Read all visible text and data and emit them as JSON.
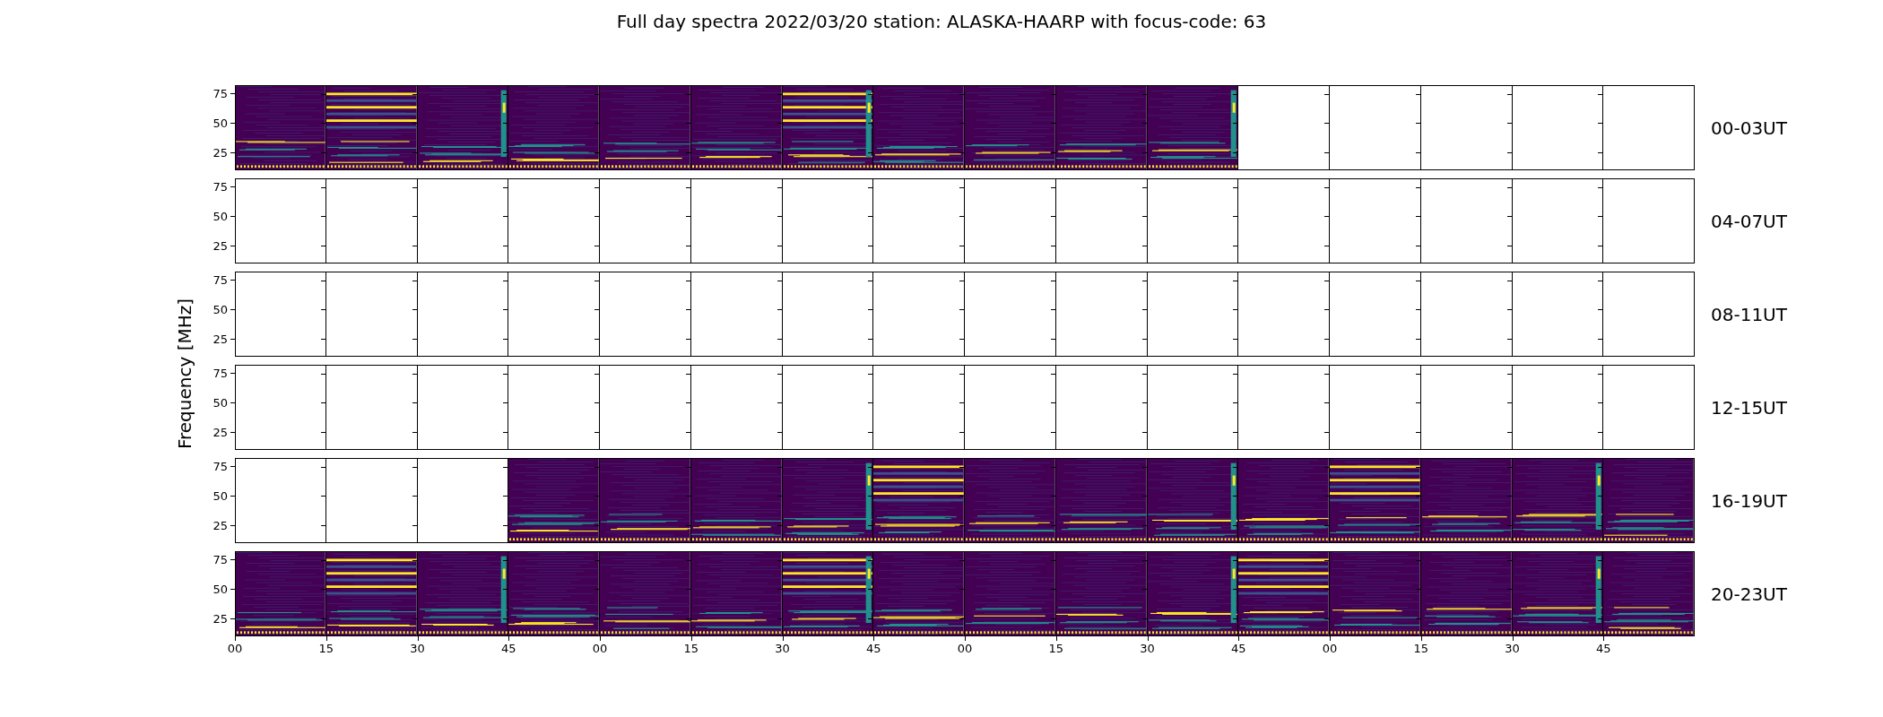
{
  "title": "Full day spectra 2022/03/20 station: ALASKA-HAARP with focus-code: 63",
  "ylabel": "Frequency [MHz]",
  "x_ticks": [
    "00",
    "15",
    "30",
    "45",
    "00",
    "15",
    "30",
    "45",
    "00",
    "15",
    "30",
    "45",
    "00",
    "15",
    "30",
    "45"
  ],
  "rows": [
    {
      "label": "00-03UT",
      "y_ticks": [
        "75",
        "50",
        "25"
      ],
      "panels": [
        {
          "has_data": true
        },
        {
          "has_data": true
        },
        {
          "has_data": true
        },
        {
          "has_data": true
        },
        {
          "has_data": true
        },
        {
          "has_data": true
        },
        {
          "has_data": true
        },
        {
          "has_data": true
        },
        {
          "has_data": true
        },
        {
          "has_data": true
        },
        {
          "has_data": true
        },
        {
          "has_data": false
        },
        {
          "has_data": false
        },
        {
          "has_data": false
        },
        {
          "has_data": false
        },
        {
          "has_data": false
        }
      ]
    },
    {
      "label": "04-07UT",
      "y_ticks": [
        "75",
        "50",
        "25"
      ],
      "panels": [
        {
          "has_data": false
        },
        {
          "has_data": false
        },
        {
          "has_data": false
        },
        {
          "has_data": false
        },
        {
          "has_data": false
        },
        {
          "has_data": false
        },
        {
          "has_data": false
        },
        {
          "has_data": false
        },
        {
          "has_data": false
        },
        {
          "has_data": false
        },
        {
          "has_data": false
        },
        {
          "has_data": false
        },
        {
          "has_data": false
        },
        {
          "has_data": false
        },
        {
          "has_data": false
        },
        {
          "has_data": false
        }
      ]
    },
    {
      "label": "08-11UT",
      "y_ticks": [
        "75",
        "50",
        "25"
      ],
      "panels": [
        {
          "has_data": false
        },
        {
          "has_data": false
        },
        {
          "has_data": false
        },
        {
          "has_data": false
        },
        {
          "has_data": false
        },
        {
          "has_data": false
        },
        {
          "has_data": false
        },
        {
          "has_data": false
        },
        {
          "has_data": false
        },
        {
          "has_data": false
        },
        {
          "has_data": false
        },
        {
          "has_data": false
        },
        {
          "has_data": false
        },
        {
          "has_data": false
        },
        {
          "has_data": false
        },
        {
          "has_data": false
        }
      ]
    },
    {
      "label": "12-15UT",
      "y_ticks": [
        "75",
        "50",
        "25"
      ],
      "panels": [
        {
          "has_data": false
        },
        {
          "has_data": false
        },
        {
          "has_data": false
        },
        {
          "has_data": false
        },
        {
          "has_data": false
        },
        {
          "has_data": false
        },
        {
          "has_data": false
        },
        {
          "has_data": false
        },
        {
          "has_data": false
        },
        {
          "has_data": false
        },
        {
          "has_data": false
        },
        {
          "has_data": false
        },
        {
          "has_data": false
        },
        {
          "has_data": false
        },
        {
          "has_data": false
        },
        {
          "has_data": false
        }
      ]
    },
    {
      "label": "16-19UT",
      "y_ticks": [
        "75",
        "50",
        "25"
      ],
      "panels": [
        {
          "has_data": false
        },
        {
          "has_data": false
        },
        {
          "has_data": false
        },
        {
          "has_data": true
        },
        {
          "has_data": true
        },
        {
          "has_data": true
        },
        {
          "has_data": true
        },
        {
          "has_data": true
        },
        {
          "has_data": true
        },
        {
          "has_data": true
        },
        {
          "has_data": true
        },
        {
          "has_data": true
        },
        {
          "has_data": true
        },
        {
          "has_data": true
        },
        {
          "has_data": true
        },
        {
          "has_data": true
        }
      ]
    },
    {
      "label": "20-23UT",
      "y_ticks": [
        "75",
        "50",
        "25"
      ],
      "panels": [
        {
          "has_data": true
        },
        {
          "has_data": true
        },
        {
          "has_data": true
        },
        {
          "has_data": true
        },
        {
          "has_data": true
        },
        {
          "has_data": true
        },
        {
          "has_data": true
        },
        {
          "has_data": true
        },
        {
          "has_data": true
        },
        {
          "has_data": true
        },
        {
          "has_data": true
        },
        {
          "has_data": true
        },
        {
          "has_data": true
        },
        {
          "has_data": true
        },
        {
          "has_data": true
        },
        {
          "has_data": true
        }
      ]
    }
  ]
}
